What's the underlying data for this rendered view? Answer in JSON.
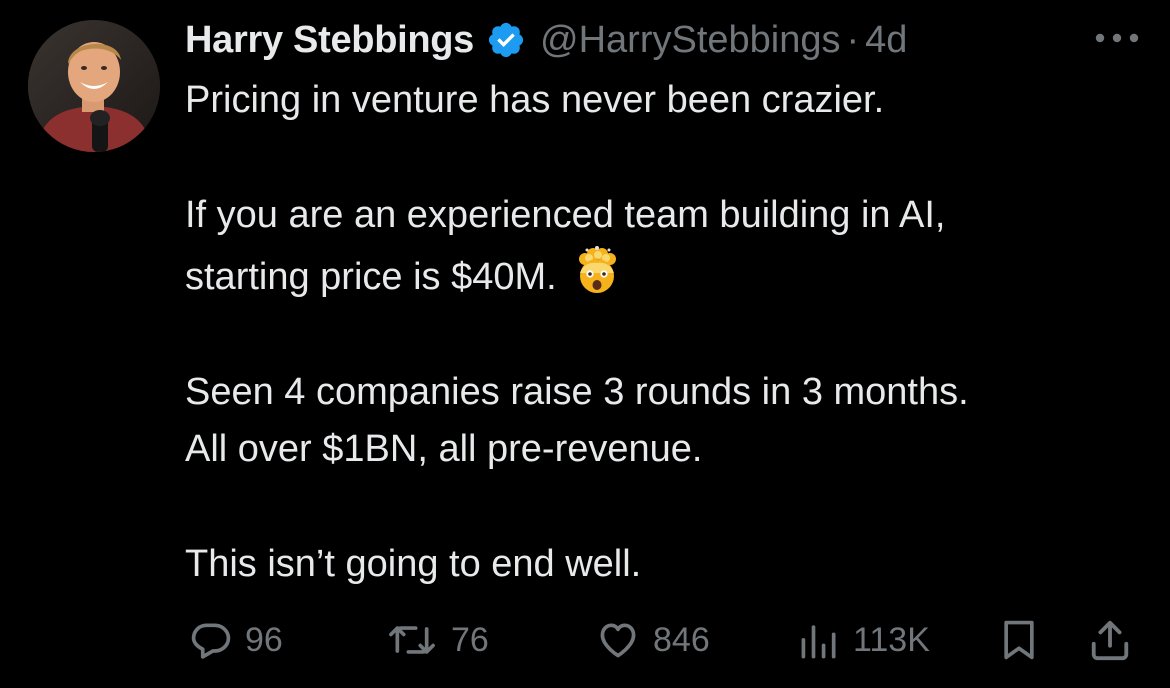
{
  "author": {
    "display_name": "Harry Stebbings",
    "handle": "@HarryStebbings",
    "separator": "·",
    "time_ago": "4d",
    "verified_icon": "verified-badge-icon",
    "verified_color": "#1d9bf0"
  },
  "tweet": {
    "line_1": "Pricing in venture has never been crazier.",
    "line_2": "If you are an experienced team building in AI,",
    "line_3": "starting price is $40M.",
    "line_3_emoji": "exploding-head-emoji",
    "line_4": "Seen 4 companies raise 3 rounds in 3 months.",
    "line_5": "All over $1BN, all pre-revenue.",
    "line_6": "This isn’t going to end well."
  },
  "actions": {
    "replies": "96",
    "reposts": "76",
    "likes": "846",
    "views": "113K"
  },
  "colors": {
    "background": "#000000",
    "text": "#e7e9ea",
    "muted": "#71767b",
    "accent": "#1d9bf0"
  }
}
